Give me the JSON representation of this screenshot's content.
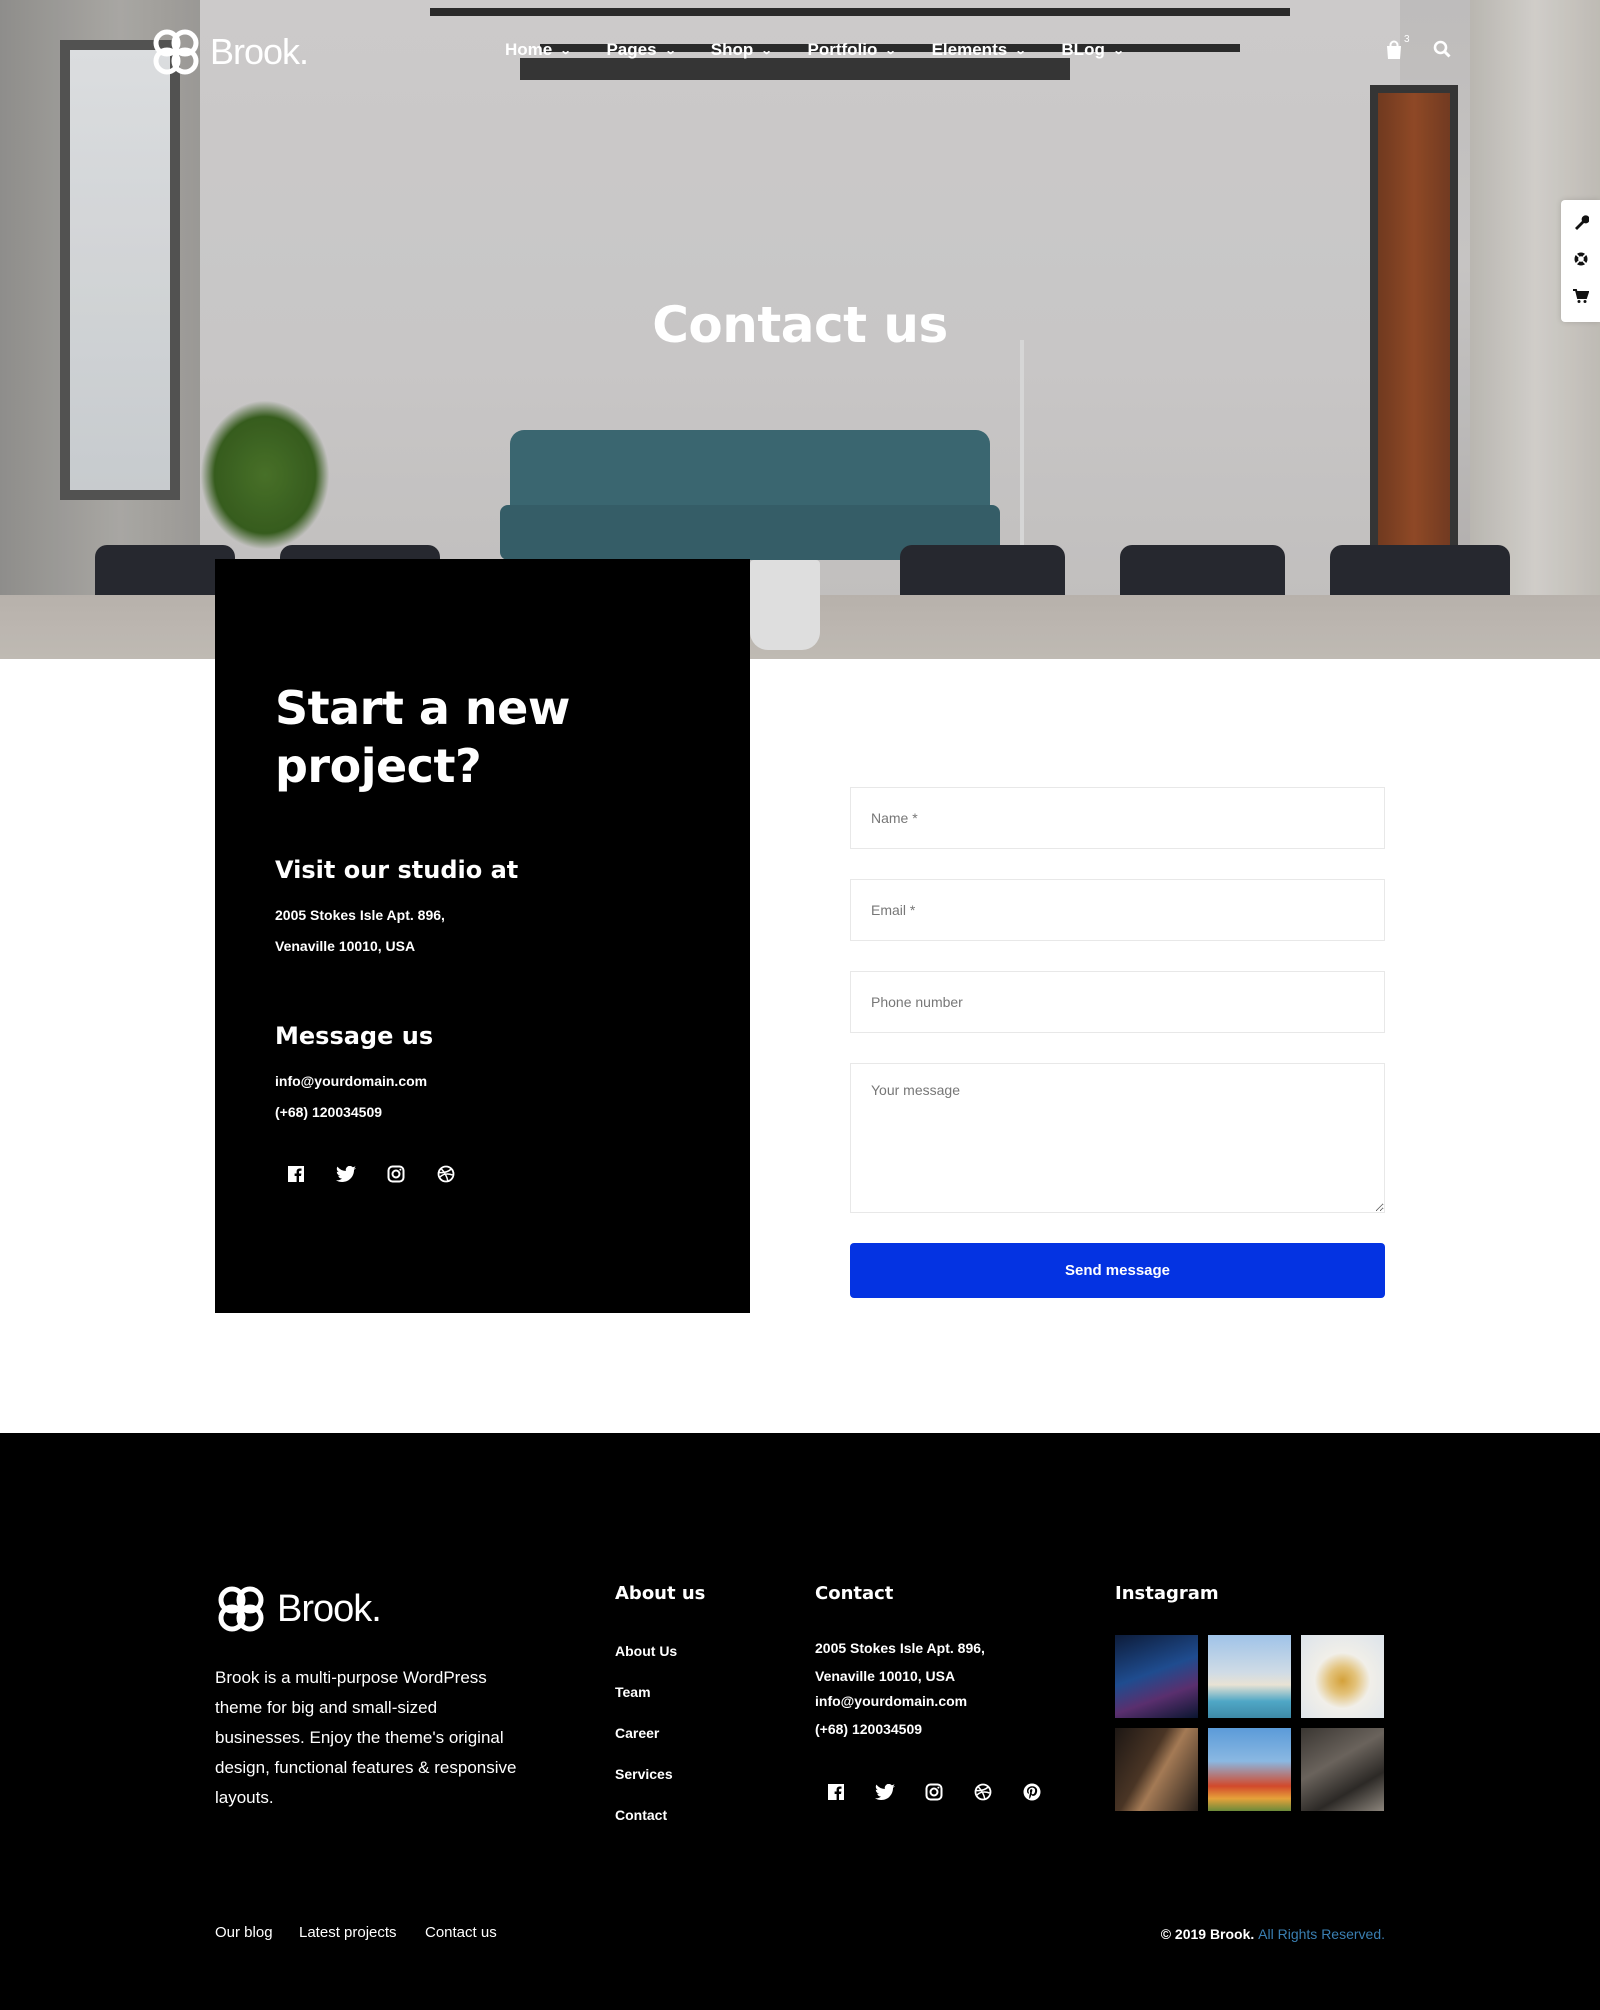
{
  "header": {
    "logo_text": "Brook.",
    "nav": [
      {
        "label": "Home"
      },
      {
        "label": "Pages"
      },
      {
        "label": "Shop"
      },
      {
        "label": "Portfolio"
      },
      {
        "label": "Elements"
      },
      {
        "label": "BLog"
      }
    ],
    "cart_count": "3",
    "icons": [
      "shopping-bag-icon",
      "search-icon"
    ]
  },
  "side_tools": [
    "wrench-icon",
    "lifebuoy-icon",
    "cart-icon"
  ],
  "hero": {
    "title": "Contact us"
  },
  "info": {
    "headline": "Start a new project?",
    "visit_title": "Visit our studio at",
    "address_line1": "2005 Stokes Isle Apt. 896,",
    "address_line2": "Venaville 10010, USA",
    "message_title": "Message us",
    "email": "info@yourdomain.com",
    "phone": "(+68) 120034509",
    "social": [
      "facebook-icon",
      "twitter-icon",
      "instagram-icon",
      "dribbble-icon"
    ]
  },
  "form": {
    "name_placeholder": "Name *",
    "email_placeholder": "Email *",
    "phone_placeholder": "Phone number",
    "message_placeholder": "Your message",
    "submit_label": "Send message",
    "accent_color": "#0433e2"
  },
  "footer": {
    "logo_text": "Brook.",
    "description": "Brook is a multi-purpose WordPress theme for big and small-sized businesses. Enjoy the theme's original design, functional features & responsive layouts.",
    "about_title": "About us",
    "about_links": [
      "About Us",
      "Team",
      "Career",
      "Services",
      "Contact"
    ],
    "contact_title": "Contact",
    "contact_address1": "2005 Stokes Isle Apt. 896,",
    "contact_address2": "Venaville 10010, USA",
    "contact_email": "info@yourdomain.com",
    "contact_phone": "(+68) 120034509",
    "social": [
      "facebook-icon",
      "twitter-icon",
      "instagram-icon",
      "dribbble-icon",
      "pinterest-icon"
    ],
    "instagram_title": "Instagram",
    "bottom_links": [
      "Our blog",
      "Latest projects",
      "Contact us"
    ],
    "copyright_main": "© 2019 Brook.",
    "copyright_rest": "All Rights Reserved."
  }
}
